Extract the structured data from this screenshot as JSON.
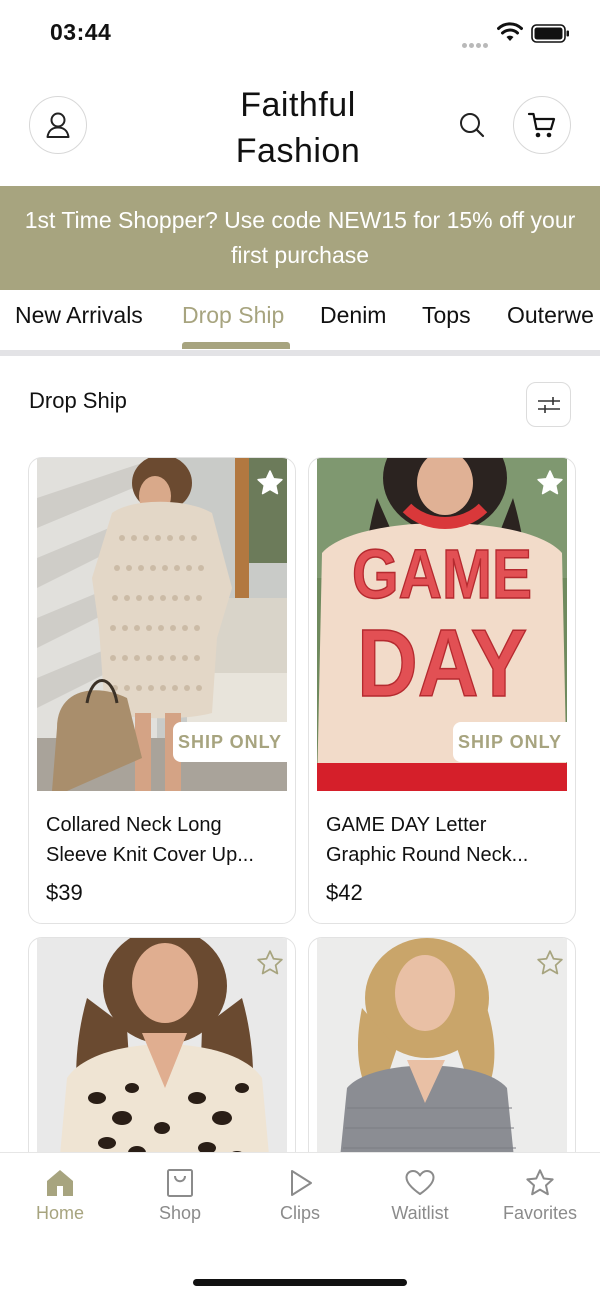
{
  "status": {
    "time": "03:44"
  },
  "header": {
    "brand_line1": "Faithful",
    "brand_line2": "Fashion",
    "icons": [
      "account-icon",
      "search-icon",
      "cart-icon"
    ]
  },
  "promo": {
    "line1": "1st Time Shopper? Use code NEW15 for 15% off your",
    "line2": "first purchase"
  },
  "tabs": [
    {
      "label": "New Arrivals",
      "active": false
    },
    {
      "label": "Drop Ship",
      "active": true
    },
    {
      "label": "Denim",
      "active": false
    },
    {
      "label": "Tops",
      "active": false
    },
    {
      "label": "Outerwe",
      "active": false
    }
  ],
  "section": {
    "title": "Drop Ship"
  },
  "products": [
    {
      "title_line1": "Collared Neck Long",
      "title_line2": "Sleeve Knit Cover Up...",
      "price": "$39",
      "badge": "SHIP ONLY"
    },
    {
      "title_line1": "GAME DAY Letter",
      "title_line2": "Graphic Round Neck...",
      "price": "$42",
      "badge": "SHIP ONLY",
      "print_line1": "GAME",
      "print_line2": "DAY"
    },
    {
      "title_line1": "",
      "title_line2": "",
      "price": "",
      "badge": ""
    },
    {
      "title_line1": "",
      "title_line2": "",
      "price": "",
      "badge": ""
    }
  ],
  "nav": [
    {
      "label": "Home",
      "icon": "home-icon",
      "active": true
    },
    {
      "label": "Shop",
      "icon": "shop-icon",
      "active": false
    },
    {
      "label": "Clips",
      "icon": "play-icon",
      "active": false
    },
    {
      "label": "Waitlist",
      "icon": "heart-icon",
      "active": false
    },
    {
      "label": "Favorites",
      "icon": "star-icon",
      "active": false
    }
  ],
  "colors": {
    "accent": "#a7a47f",
    "text": "#111111",
    "muted": "#8b8b8b"
  }
}
